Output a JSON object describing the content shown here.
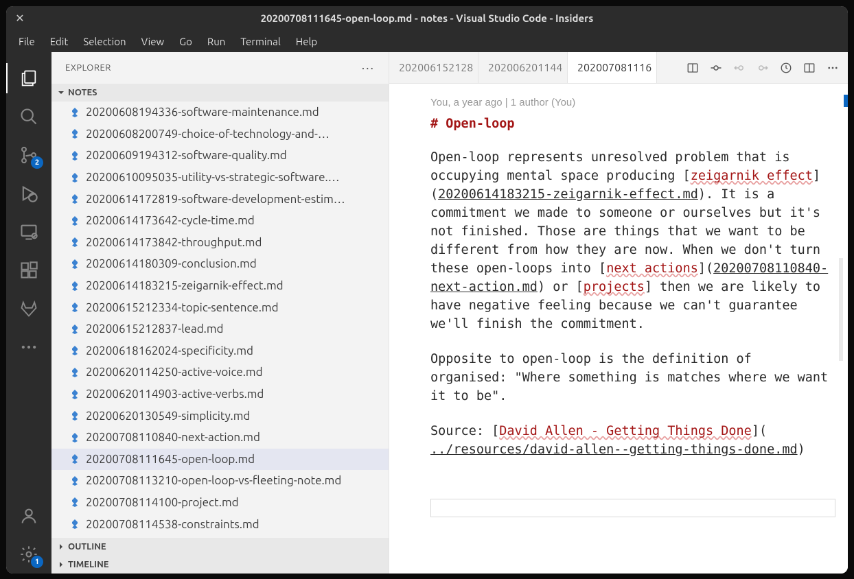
{
  "titlebar": {
    "title": "20200708111645-open-loop.md - notes - Visual Studio Code - Insiders"
  },
  "menubar": [
    "File",
    "Edit",
    "Selection",
    "View",
    "Go",
    "Run",
    "Terminal",
    "Help"
  ],
  "activitybar": {
    "scm_badge": "2",
    "settings_badge": "1"
  },
  "sidebar": {
    "title": "EXPLORER",
    "section": "NOTES",
    "outline": "OUTLINE",
    "timeline": "TIMELINE",
    "files": [
      {
        "name": "20200608194336-software-maintenance.md",
        "selected": false
      },
      {
        "name": "20200608200749-choice-of-technology-and-…",
        "selected": false
      },
      {
        "name": "20200609194312-software-quality.md",
        "selected": false
      },
      {
        "name": "20200610095035-utility-vs-strategic-software.…",
        "selected": false
      },
      {
        "name": "20200614172819-software-development-estim…",
        "selected": false
      },
      {
        "name": "20200614173642-cycle-time.md",
        "selected": false
      },
      {
        "name": "20200614173842-throughput.md",
        "selected": false
      },
      {
        "name": "20200614180309-conclusion.md",
        "selected": false
      },
      {
        "name": "20200614183215-zeigarnik-effect.md",
        "selected": false
      },
      {
        "name": "20200615212334-topic-sentence.md",
        "selected": false
      },
      {
        "name": "20200615212837-lead.md",
        "selected": false
      },
      {
        "name": "20200618162024-specificity.md",
        "selected": false
      },
      {
        "name": "20200620114250-active-voice.md",
        "selected": false
      },
      {
        "name": "20200620114903-active-verbs.md",
        "selected": false
      },
      {
        "name": "20200620130549-simplicity.md",
        "selected": false
      },
      {
        "name": "20200708110840-next-action.md",
        "selected": false
      },
      {
        "name": "20200708111645-open-loop.md",
        "selected": true
      },
      {
        "name": "20200708113210-open-loop-vs-fleeting-note.md",
        "selected": false
      },
      {
        "name": "20200708114100-project.md",
        "selected": false
      },
      {
        "name": "20200708114538-constraints.md",
        "selected": false
      }
    ]
  },
  "tabs": [
    {
      "label": "202006152128",
      "active": false
    },
    {
      "label": "202006201144",
      "active": false
    },
    {
      "label": "202007081116",
      "active": true
    }
  ],
  "editor": {
    "blame": "You, a year ago | 1 author (You)",
    "heading": "# Open-loop",
    "p1_a": "Open-loop represents unresolved problem that is occupying mental space producing [",
    "p1_link1_text": "zeigarnik effect",
    "p1_link1_url": "20200614183215-zeigarnik-effect.md",
    "p1_b": "). It is a commitment we made to someone or ourselves but it's not finished. Those are things that we want to be different from how they are now. When we don't turn these open-loops into [",
    "p1_link2_text": "next actions",
    "p1_link2_url": "20200708110840-next-action.md",
    "p1_c": ") or [",
    "p1_link3_text": "projects",
    "p1_d": "] then we are likely to have negative feeling because we can't guarantee we'll finish the commitment.",
    "p2": "Opposite to open-loop is the definition of organised: \"Where something is matches where we want it to be\".",
    "p3_a": "Source: [",
    "p3_link_text": "David Allen - Getting Things Done",
    "p3_link_url": "../resources/david-allen--getting-things-done.md",
    "p3_b": ")"
  }
}
